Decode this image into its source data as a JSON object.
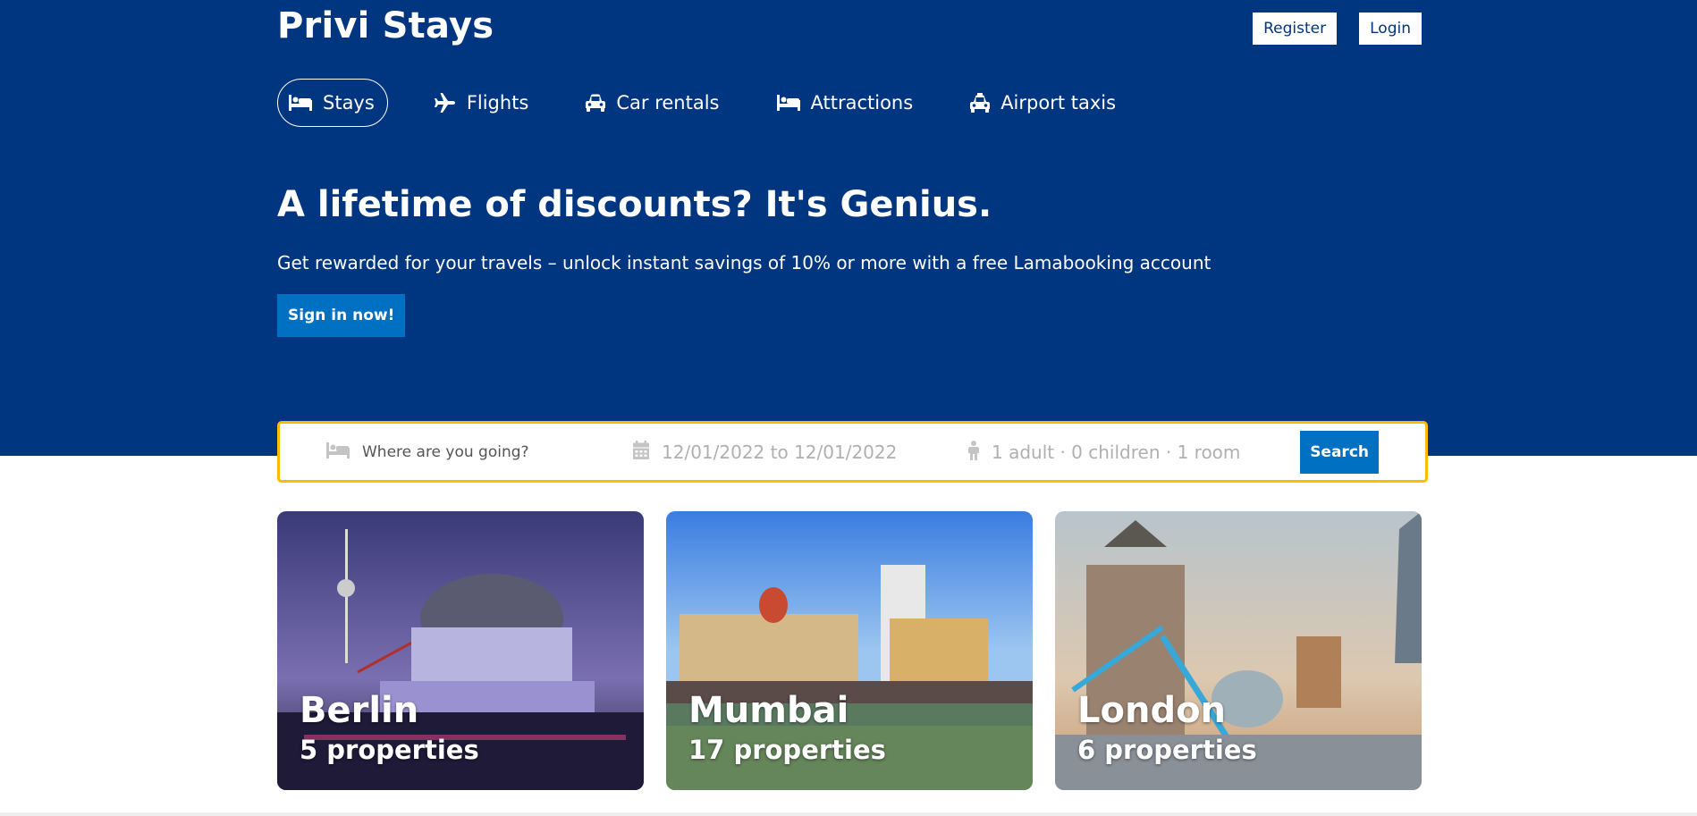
{
  "header": {
    "logo": "Privi Stays",
    "register_label": "Register",
    "login_label": "Login"
  },
  "nav": {
    "items": [
      {
        "label": "Stays",
        "icon": "bed-icon",
        "active": true
      },
      {
        "label": "Flights",
        "icon": "plane-icon"
      },
      {
        "label": "Car rentals",
        "icon": "car-icon"
      },
      {
        "label": "Attractions",
        "icon": "bed-icon"
      },
      {
        "label": "Airport taxis",
        "icon": "taxi-icon"
      }
    ]
  },
  "hero": {
    "title": "A lifetime of discounts? It's Genius.",
    "description": "Get rewarded for your travels – unlock instant savings of 10% or more with a free Lamabooking account",
    "signin_label": "Sign in now!"
  },
  "search": {
    "destination_placeholder": "Where are you going?",
    "dates": "12/01/2022 to 12/01/2022",
    "options": "1 adult · 0 children · 1 room",
    "search_label": "Search"
  },
  "featured": [
    {
      "city": "Berlin",
      "properties": "5 properties"
    },
    {
      "city": "Mumbai",
      "properties": "17 properties"
    },
    {
      "city": "London",
      "properties": "6 properties"
    }
  ],
  "colors": {
    "header_bg": "#003580",
    "primary_button": "#0071c2",
    "search_border": "#febb02"
  }
}
